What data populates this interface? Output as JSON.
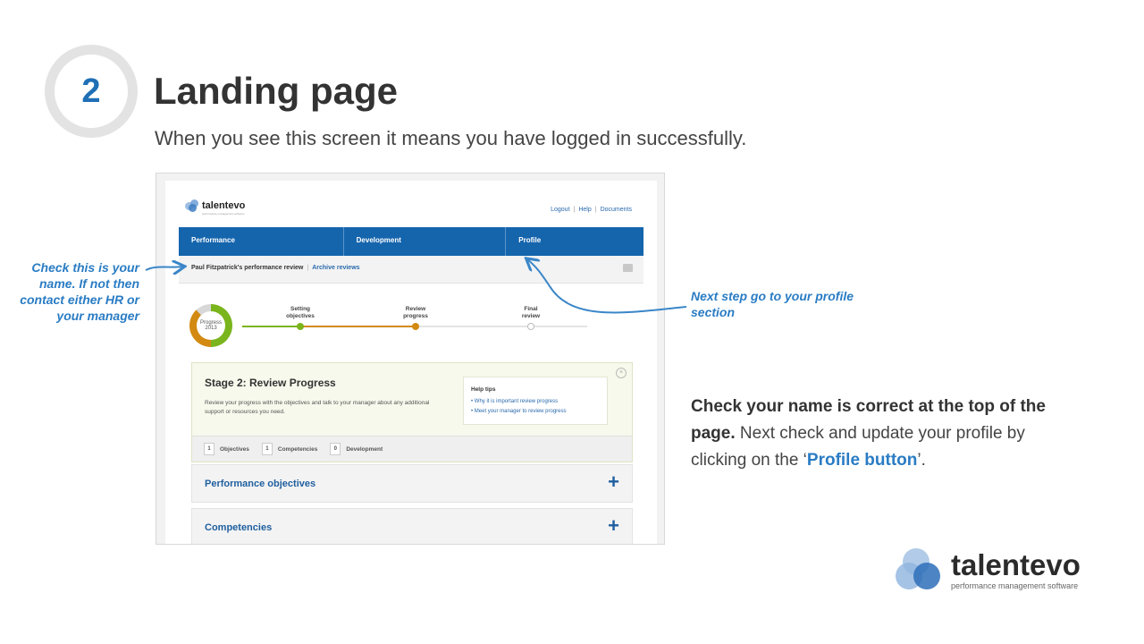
{
  "step": {
    "number": "2",
    "title": "Landing page",
    "subtitle": "When you see this screen it means you have logged in successfully."
  },
  "app": {
    "brand": "talentevo",
    "brand_tagline": "performance management software",
    "top_links": [
      "Logout",
      "Help",
      "Documents"
    ],
    "tabs": [
      {
        "label": "Performance",
        "active": true
      },
      {
        "label": "Development"
      },
      {
        "label": "Profile"
      }
    ],
    "review_title": "Paul Fitzpatrick's performance review",
    "archive_link": "Archive reviews",
    "progress": {
      "label": "Progress",
      "year": "2013"
    },
    "stages": [
      {
        "label_1": "Setting",
        "label_2": "objectives",
        "color": "#7ab51d"
      },
      {
        "label_1": "Review",
        "label_2": "progress",
        "color": "#d28a12"
      },
      {
        "label_1": "Final",
        "label_2": "review",
        "color": "#ffffff"
      }
    ],
    "stage_box": {
      "title": "Stage 2: Review Progress",
      "description": "Review your progress with the objectives and talk to your manager about any additional support or resources you need.",
      "help_title": "Help tips",
      "help_items": [
        "Why it is important review progress",
        "Meet your manager to review progress"
      ],
      "counts": [
        {
          "n": "1",
          "label": "Objectives"
        },
        {
          "n": "1",
          "label": "Competencies"
        },
        {
          "n": "0",
          "label": "Development"
        }
      ]
    },
    "sections": [
      "Performance objectives",
      "Competencies"
    ]
  },
  "annotations": {
    "left": "Check this is your name. If not then contact either HR or your manager",
    "right": "Next step go to your profile section"
  },
  "instruction": {
    "bold": "Check your name is correct at the top of the page.",
    "text": " Next check and update your profile by clicking on the ‘",
    "link": "Profile button",
    "end": "’."
  },
  "footer_logo": {
    "brand": "talentevo",
    "tagline": "performance management software"
  },
  "colors": {
    "accent": "#2a7cc4",
    "nav": "#1565ad",
    "green": "#7ab51d",
    "orange": "#d28a12"
  }
}
